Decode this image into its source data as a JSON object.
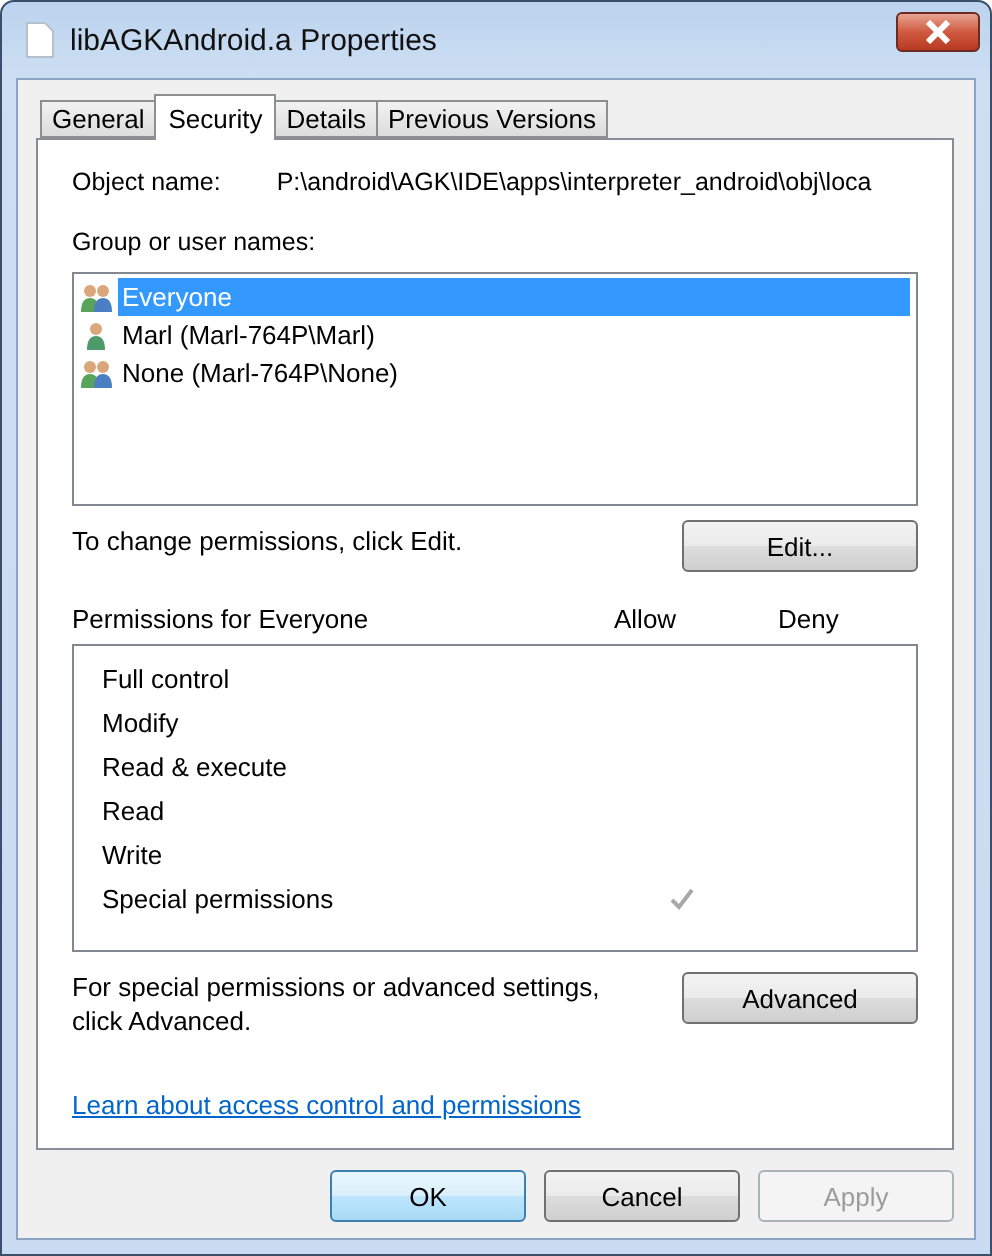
{
  "window": {
    "title": "libAGKAndroid.a Properties"
  },
  "tabs": [
    {
      "label": "General",
      "selected": false
    },
    {
      "label": "Security",
      "selected": true
    },
    {
      "label": "Details",
      "selected": false
    },
    {
      "label": "Previous Versions",
      "selected": false
    }
  ],
  "object_name": {
    "label": "Object name:",
    "value": "P:\\android\\AGK\\IDE\\apps\\interpreter_android\\obj\\loca"
  },
  "principals": {
    "label": "Group or user names:",
    "items": [
      {
        "name": "Everyone",
        "kind": "group",
        "selected": true
      },
      {
        "name": "Marl (Marl-764P\\Marl)",
        "kind": "user",
        "selected": false
      },
      {
        "name": "None (Marl-764P\\None)",
        "kind": "group",
        "selected": false
      }
    ]
  },
  "edit_hint": "To change permissions, click Edit.",
  "edit_button": "Edit...",
  "permissions": {
    "label": "Permissions for Everyone",
    "allow_heading": "Allow",
    "deny_heading": "Deny",
    "rows": [
      {
        "name": "Full control",
        "allow": false,
        "deny": false
      },
      {
        "name": "Modify",
        "allow": false,
        "deny": false
      },
      {
        "name": "Read & execute",
        "allow": false,
        "deny": false
      },
      {
        "name": "Read",
        "allow": false,
        "deny": false
      },
      {
        "name": "Write",
        "allow": false,
        "deny": false
      },
      {
        "name": "Special permissions",
        "allow": true,
        "deny": false
      }
    ]
  },
  "advanced_hint": "For special permissions or advanced settings, click Advanced.",
  "advanced_button": "Advanced",
  "link": "Learn about access control and permissions",
  "buttons": [
    {
      "label": "OK",
      "kind": "default",
      "disabled": false
    },
    {
      "label": "Cancel",
      "kind": "normal",
      "disabled": false
    },
    {
      "label": "Apply",
      "kind": "normal",
      "disabled": true
    }
  ]
}
